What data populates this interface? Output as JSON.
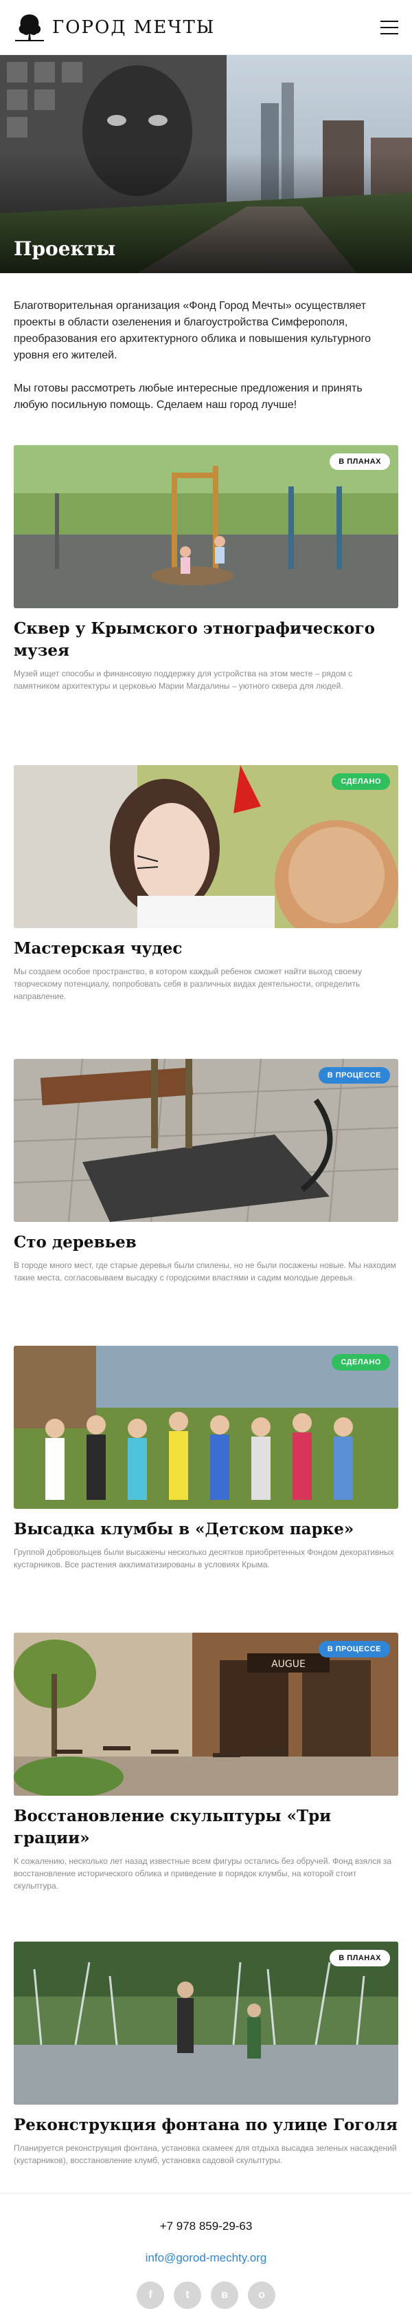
{
  "header": {
    "logo_text": "ГОРОД МЕЧТЫ",
    "menu_icon": "hamburger-icon"
  },
  "hero": {
    "title": "Проекты"
  },
  "intro": {
    "paragraph1": "Благотворительная организация «Фонд Город Мечты» осуществляет проекты в области озеленения и благоустройства Симферополя, преобразования его архитектурного облика и повышения культурного уровня его жителей.",
    "paragraph2": "Мы готовы рассмотреть любые интересные предложения и принять любую посильную помощь. Сделаем наш город лучше!"
  },
  "projects": [
    {
      "badge": "В ПЛАНАХ",
      "status": "plan",
      "title": "Сквер у Крымского этнографического музея",
      "desc": "Музей ищет способы и финансовую поддержку для устройства на этом месте – рядом с памятником архитектуры и церковью Марии Магдалины – уютного сквера для людей."
    },
    {
      "badge": "СДЕЛАНО",
      "status": "done",
      "title": "Мастерская чудес",
      "desc": "Мы создаем особое пространство, в котором каждый ребенок сможет найти выход своему творческому потенциалу, попробовать себя в различных видах деятельности, определить направление."
    },
    {
      "badge": "В ПРОЦЕССЕ",
      "status": "process",
      "title": "Сто деревьев",
      "desc": "В городе много мест, где старые деревья были спилены, но не были посажены новые. Мы находим такие места, согласовываем высадку с городскими властями и садим молодые деревья."
    },
    {
      "badge": "СДЕЛАНО",
      "status": "done",
      "title": "Высадка клумбы в «Детском парке»",
      "desc": "Группой добровольцев были высажены несколько десятков приобретенных Фондом декоративных кустарников. Все растения акклиматизированы в условиях Крыма."
    },
    {
      "badge": "В ПРОЦЕССЕ",
      "status": "process",
      "title": "Восстановление скульптуры «Три грации»",
      "desc": "К сожалению, несколько лет назад известные всем фигуры остались без обручей. Фонд взялся за восстановление исторического облика и приведение в порядок клумбы, на которой стоит скульптура.",
      "sign": "AUGUE"
    },
    {
      "badge": "В ПЛАНАХ",
      "status": "plan",
      "title": "Реконструкция фонтана по улице Гоголя",
      "desc": "Планируется реконструкция фонтана, установка скамеек для отдыха высадка зеленых насаждений (кустарников), восстановление клумб, установка садовой скульптуры."
    }
  ],
  "footer": {
    "phone": "+7 978 859-29-63",
    "email": "info@gorod-mechty.org",
    "socials": [
      {
        "icon": "facebook-icon",
        "glyph": "f"
      },
      {
        "icon": "twitter-icon",
        "glyph": "t"
      },
      {
        "icon": "vk-icon",
        "glyph": "в"
      },
      {
        "icon": "odnoklassniki-icon",
        "glyph": "о"
      }
    ]
  },
  "colors": {
    "done": "#2fbf5f",
    "process": "#2f86d6",
    "plan": "#ffffff",
    "accent": "#2f86d6"
  }
}
